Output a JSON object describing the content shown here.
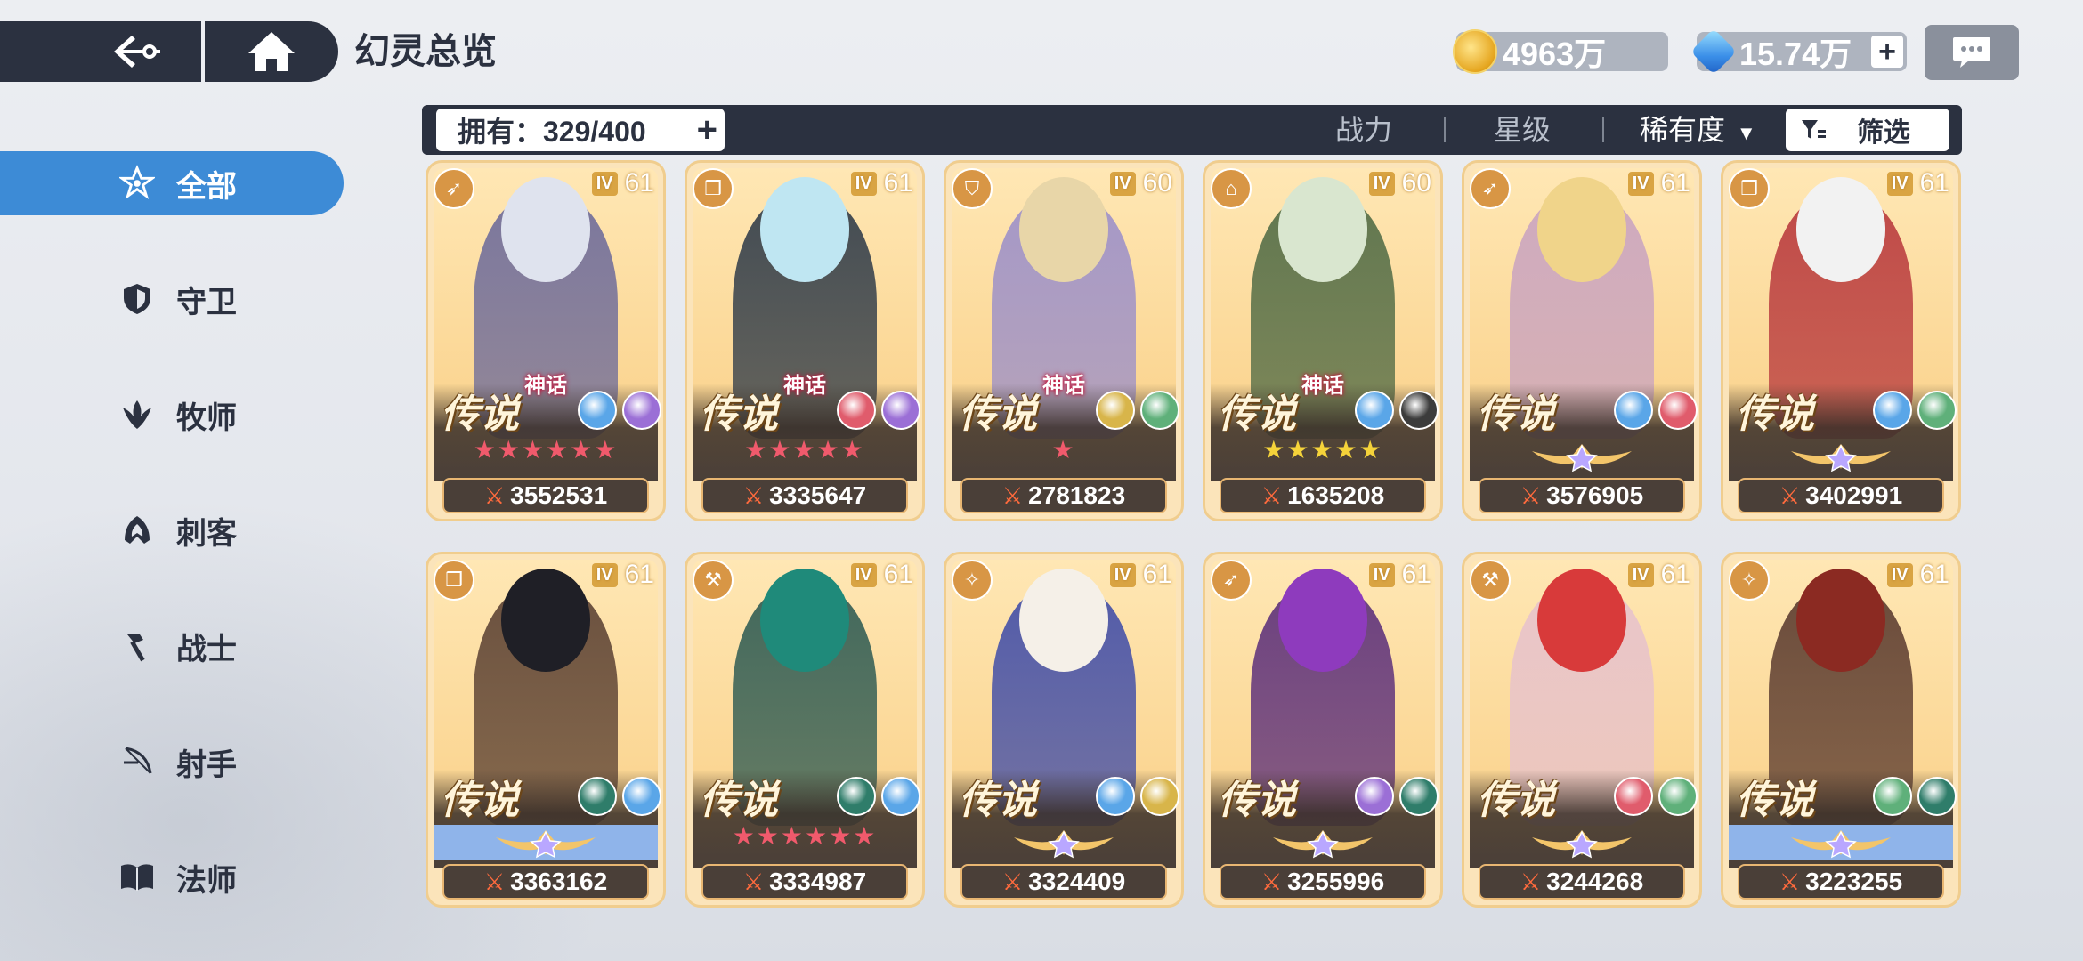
{
  "header": {
    "title": "幻灵总览"
  },
  "resources": {
    "gold": "4963万",
    "gems": "15.74万",
    "gem_plus": "+"
  },
  "sidebar": {
    "items": [
      {
        "label": "全部",
        "icon": "star-icon",
        "active": true
      },
      {
        "label": "守卫",
        "icon": "shield-icon"
      },
      {
        "label": "牧师",
        "icon": "wing-icon"
      },
      {
        "label": "刺客",
        "icon": "hood-icon"
      },
      {
        "label": "战士",
        "icon": "hammer-icon"
      },
      {
        "label": "射手",
        "icon": "bow-icon"
      },
      {
        "label": "法师",
        "icon": "book-icon"
      }
    ]
  },
  "toolbar": {
    "owned_label": "拥有：329/400",
    "owned_plus": "+",
    "sort_power": "战力",
    "sort_star": "星级",
    "sort_rarity": "稀有度",
    "filter_label": "筛选"
  },
  "cards": [
    {
      "class_icon": "bow-icon",
      "level": "61",
      "mythic": "神话",
      "rarity": "传说",
      "stars": "★★★★★★",
      "star_color": "#f05a6c",
      "elements": [
        "#5aa6e8",
        "#9b6fd6"
      ],
      "power": "3552531",
      "palette": {
        "fig": "#6c6a9a",
        "hair": "#dfe3ee"
      }
    },
    {
      "class_icon": "book-icon",
      "level": "61",
      "mythic": "神话",
      "rarity": "传说",
      "stars": "★★★★★",
      "star_color": "#f05a6c",
      "elements": [
        "#e05c6c",
        "#9b6fd6"
      ],
      "power": "3335647",
      "palette": {
        "fig": "#2e3a48",
        "hair": "#bfe6f2"
      }
    },
    {
      "class_icon": "shield-icon",
      "level": "60",
      "mythic": "神话",
      "rarity": "传说",
      "stars": "★",
      "star_color": "#f05a6c",
      "elements": [
        "#d8b54a",
        "#5fb07a"
      ],
      "power": "2781823",
      "palette": {
        "fig": "#9b8fc9",
        "hair": "#e8d6a8"
      }
    },
    {
      "class_icon": "hood-icon",
      "level": "60",
      "mythic": "神话",
      "rarity": "传说",
      "stars": "★★★★★",
      "star_color": "#f5d33a",
      "elements": [
        "#5aa6e8",
        "#3c3c3c"
      ],
      "power": "1635208",
      "palette": {
        "fig": "#4f6a44",
        "hair": "#d9e6cf"
      }
    },
    {
      "class_icon": "bow-icon",
      "level": "61",
      "mythic": "",
      "rarity": "传说",
      "stars": "",
      "star_color": "#f05a6c",
      "elements": [
        "#5aa6e8",
        "#e05c6c"
      ],
      "power": "3576905",
      "palette": {
        "fig": "#c9a3c0",
        "hair": "#f0d48a"
      }
    },
    {
      "class_icon": "book-icon",
      "level": "61",
      "mythic": "",
      "rarity": "传说",
      "stars": "",
      "star_color": "#f05a6c",
      "elements": [
        "#5aa6e8",
        "#5fb07a"
      ],
      "power": "3402991",
      "palette": {
        "fig": "#b8383c",
        "hair": "#f2f2f2"
      }
    },
    {
      "class_icon": "book-icon",
      "level": "61",
      "mythic": "",
      "rarity": "传说",
      "stars": "",
      "star_color": "#f05a6c",
      "elements": [
        "#2f7d6a",
        "#5aa6e8"
      ],
      "power": "3363162",
      "palette": {
        "fig": "#5a4032",
        "hair": "#1f1f26"
      }
    },
    {
      "class_icon": "hammer-icon",
      "level": "61",
      "mythic": "",
      "rarity": "传说",
      "stars": "★★★★★★",
      "star_color": "#f05a6c",
      "elements": [
        "#2f7d6a",
        "#5aa6e8"
      ],
      "power": "3334987",
      "palette": {
        "fig": "#2d5a52",
        "hair": "#1f8a7a"
      }
    },
    {
      "class_icon": "wing-icon",
      "level": "61",
      "mythic": "",
      "rarity": "传说",
      "stars": "",
      "star_color": "#f05a6c",
      "elements": [
        "#5aa6e8",
        "#d8b54a"
      ],
      "power": "3324409",
      "palette": {
        "fig": "#3f4ca8",
        "hair": "#f5f0e8"
      }
    },
    {
      "class_icon": "bow-icon",
      "level": "61",
      "mythic": "",
      "rarity": "传说",
      "stars": "",
      "star_color": "#f05a6c",
      "elements": [
        "#9b6fd6",
        "#2f7d6a"
      ],
      "power": "3255996",
      "palette": {
        "fig": "#5b2e7a",
        "hair": "#8e3bbd"
      }
    },
    {
      "class_icon": "hammer-icon",
      "level": "61",
      "mythic": "",
      "rarity": "传说",
      "stars": "",
      "star_color": "#f05a6c",
      "elements": [
        "#e05c6c",
        "#5fb07a"
      ],
      "power": "3244268",
      "palette": {
        "fig": "#e7c2cc",
        "hair": "#d83a3a"
      }
    },
    {
      "class_icon": "wing-icon",
      "level": "61",
      "mythic": "",
      "rarity": "传说",
      "stars": "",
      "star_color": "#f05a6c",
      "elements": [
        "#5fb07a",
        "#2f7d6a"
      ],
      "power": "3223255",
      "palette": {
        "fig": "#5a3a2e",
        "hair": "#8b2a22"
      }
    }
  ]
}
